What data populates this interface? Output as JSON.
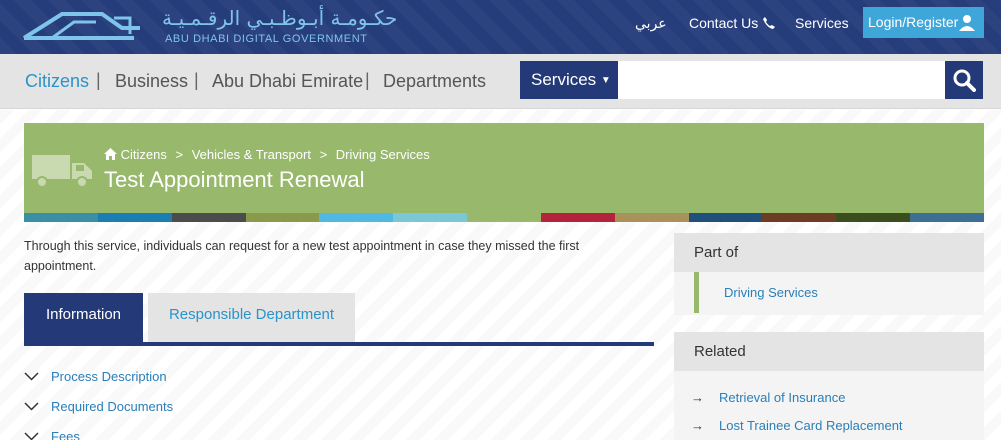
{
  "header": {
    "logo_ar": "حكـومـة أبـوظـبـي الرقـمـيـة",
    "logo_en": "ABU DHABI DIGITAL GOVERNMENT",
    "lang_link": "عربي",
    "contact_label": "Contact Us",
    "services_link": "Services",
    "login_label": "Login/Register"
  },
  "nav": {
    "items": [
      "Citizens",
      "Business",
      "Abu Dhabi Emirate",
      "Departments"
    ],
    "separator": "|",
    "services_dropdown": "Services",
    "search_placeholder": ""
  },
  "banner": {
    "breadcrumb": [
      "Citizens",
      "Vehicles & Transport",
      "Driving Services"
    ],
    "crumb_separator": ">",
    "title": "Test Appointment Renewal",
    "color_stripes": [
      "#3a8fa5",
      "#1b7eb3",
      "#4c4c4c",
      "#8a9a4a",
      "#4fb9e3",
      "#7cc7d6",
      "#98b86b",
      "#b3233b",
      "#a8925a",
      "#1f4f7a",
      "#6d3d23",
      "#3a4d1d",
      "#3c6f93"
    ]
  },
  "main": {
    "intro": "Through this service, individuals can request for a new test appointment in case they missed the first appointment.",
    "tabs": [
      "Information",
      "Responsible Department"
    ],
    "accordion": [
      "Process Description",
      "Required Documents",
      "Fees"
    ]
  },
  "sidebar": {
    "part_of_title": "Part of",
    "part_of_link": "Driving Services",
    "related_title": "Related",
    "related_items": [
      "Retrieval of Insurance",
      "Lost Trainee Card Replacement"
    ]
  },
  "colors": {
    "header_bg": "#263d7c",
    "accent_blue": "#2a93c9",
    "login_bg": "#3fa6d9",
    "banner_green": "#98b86b",
    "dark_navy": "#243a78"
  }
}
